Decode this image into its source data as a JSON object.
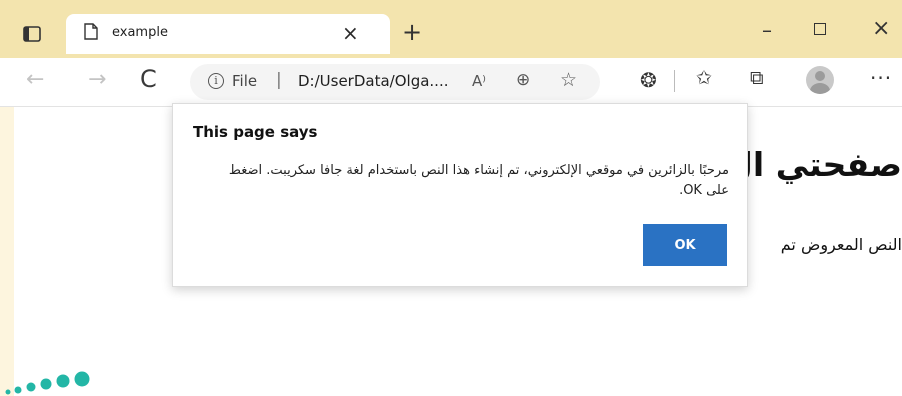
{
  "browser": {
    "tab": {
      "title": "example",
      "close_glyph": "×"
    },
    "new_tab_glyph": "+",
    "window": {
      "minimize_glyph": "–",
      "close_glyph": "×"
    },
    "toolbar": {
      "back_glyph": "←",
      "forward_glyph": "→",
      "refresh_glyph": "C",
      "address": {
        "info_glyph": "i",
        "scheme_label": "File",
        "separator": "|",
        "url": "D:/UserData/Olga....",
        "read_aloud_glyph": "A⁾",
        "zoom_glyph": "⊕",
        "favorite_add_glyph": "☆"
      },
      "extensions_glyph": "❂",
      "favorites_glyph": "✩",
      "collections_glyph": "⧉",
      "more_glyph": "···"
    }
  },
  "page": {
    "heading": "صفحتي ال",
    "text": "النص المعروض تم"
  },
  "dialog": {
    "title": "This page says",
    "message": "مرحبًا بالزائرين في موقعي الإلكتروني، تم إنشاء هذا النص باستخدام لغة جافا سكريبت. اضغط على OK.",
    "ok_label": "OK"
  },
  "colors": {
    "accent": "#2a72c3",
    "tabstrip": "#f3e4ae",
    "logo_dots": "#23b6a6"
  },
  "icons": [
    "tab-actions-icon",
    "page-icon",
    "info-icon",
    "read-aloud-icon",
    "zoom-icon",
    "favorite-add-icon",
    "extensions-icon",
    "favorites-icon",
    "collections-icon",
    "avatar",
    "more-icon",
    "logo-dots"
  ]
}
